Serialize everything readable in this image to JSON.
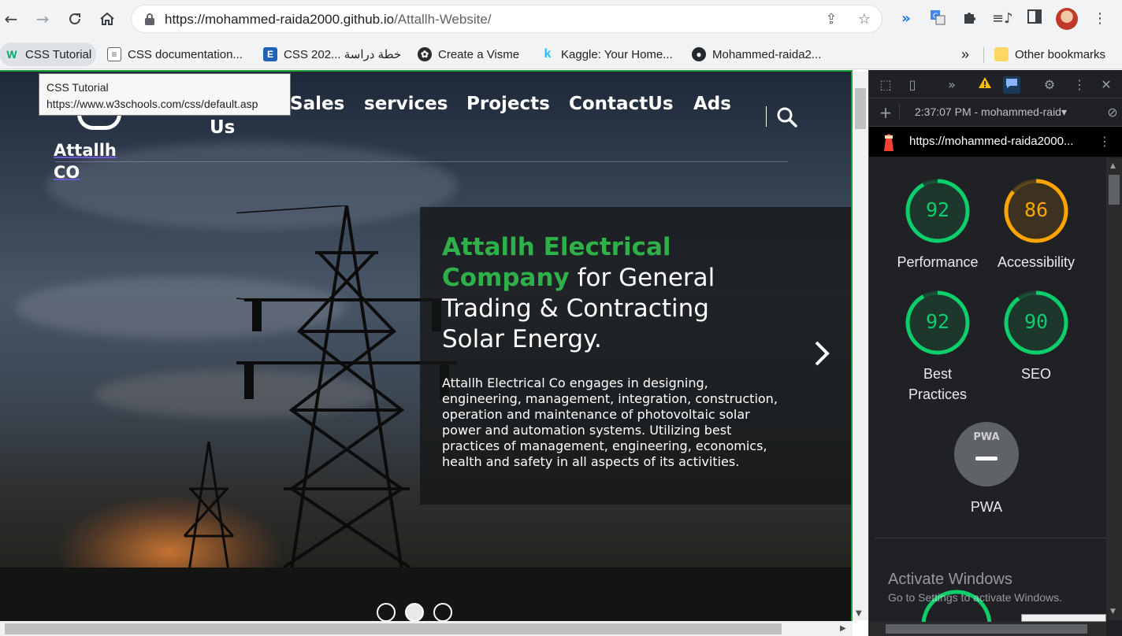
{
  "browser": {
    "url_host": "https://mohammed-raida2000.github.io",
    "url_path": "/Attallh-Website/",
    "bookmarks": [
      {
        "label": "CSS Tutorial",
        "icon": "w3schools-icon"
      },
      {
        "label": "CSS documentation...",
        "icon": "docs-icon"
      },
      {
        "label": "CSS 202... خطة دراسة",
        "icon": "e-icon"
      },
      {
        "label": "Create a Visme",
        "icon": "visme-icon"
      },
      {
        "label": "Kaggle: Your Home...",
        "icon": "kaggle-icon"
      },
      {
        "label": "Mohammed-raida2...",
        "icon": "github-icon"
      }
    ],
    "overflow_label": "»",
    "other_bookmarks": "Other bookmarks"
  },
  "tooltip": {
    "title": "CSS Tutorial",
    "url": "https://www.w3schools.com/css/default.asp"
  },
  "site": {
    "brand_line1": "Attallh",
    "brand_line2": "CO",
    "menu": [
      "Us",
      "Sales",
      "services",
      "Projects",
      "ContactUs",
      "Ads"
    ],
    "hero_title_green": "Attallh Electrical Company",
    "hero_title_rest": " for General Trading & Contracting Solar Energy.",
    "hero_body": "Attallh Electrical Co engages in designing, engineering, management, integration, construction, operation and maintenance of photovoltaic solar power and automation systems. Utilizing best practices of management, engineering, economics, health and safety in all aspects of its activities.",
    "slides": 3,
    "active_slide": 2
  },
  "devtools": {
    "report_selector": "2:37:07 PM - mohammed-raid▾",
    "report_url": "https://mohammed-raida2000...",
    "scores": [
      {
        "label": "Performance",
        "value": 92,
        "color": "#0cce6b"
      },
      {
        "label": "Accessibility",
        "value": 86,
        "color": "#ffa400"
      },
      {
        "label": "Best Practices",
        "value": 92,
        "color": "#0cce6b"
      },
      {
        "label": "SEO",
        "value": 90,
        "color": "#0cce6b"
      }
    ],
    "pwa_label": "PWA",
    "pwa_badge": "PWA"
  },
  "watermark": {
    "line1": "Activate Windows",
    "line2": "Go to Settings to activate Windows."
  }
}
